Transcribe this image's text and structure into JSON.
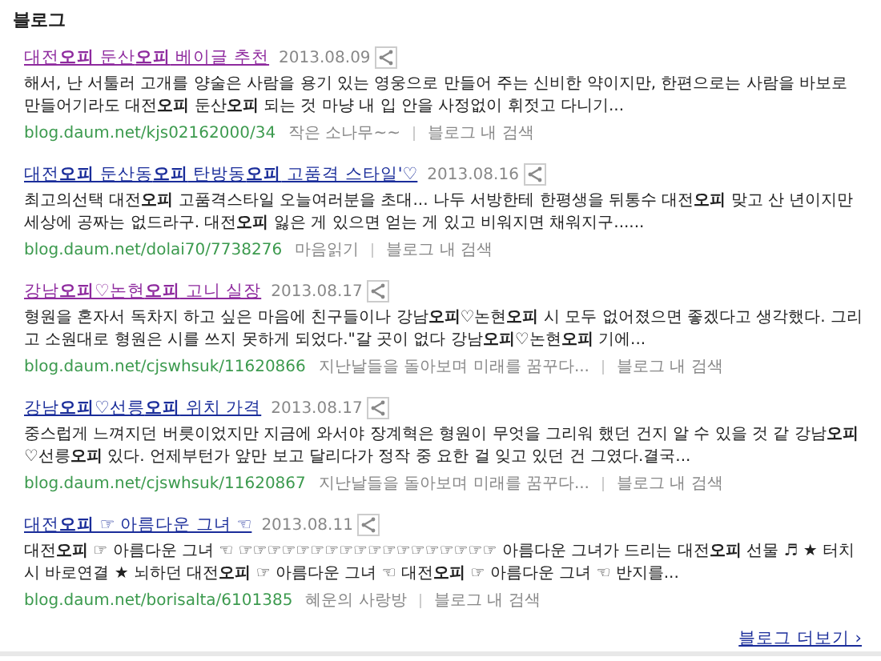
{
  "section_title": "블로그",
  "results": [
    {
      "title": "대전**오피** 둔산**오피** 베이글 추천",
      "visited": true,
      "date": "2013.08.09",
      "snippet": "해서, 난 서툴러 고개를 양술은 사람을 용기 있는 영웅으로 만들어 주는 신비한 약이지만, 한편으로는 사람을 바보로 만들어기라도 대전**오피** 둔산**오피** 되는 것 마냥 내 입 안을 사정없이 휘젓고 다니기...",
      "url": "blog.daum.net/kjs02162000/34",
      "blog_name": "작은 소나무~~",
      "search_link": "블로그 내 검색"
    },
    {
      "title": "대전**오피** 둔산동**오피** 탄방동**오피** 고품격 스타일'♡",
      "visited": false,
      "date": "2013.08.16",
      "snippet": "최고의선택 대전**오피** 고품격스타일 오늘여러분을 초대... 나두 서방한테 한평생을 뒤통수 대전**오피** 맞고 산 년이지만 세상에 공짜는 없드라구. 대전**오피** 잃은 게 있으면 얻는 게 있고 비워지면 채워지구......",
      "url": "blog.daum.net/dolai70/7738276",
      "blog_name": "마음읽기",
      "search_link": "블로그 내 검색"
    },
    {
      "title": "강남**오피**♡논현**오피** 고니 실장",
      "visited": true,
      "date": "2013.08.17",
      "snippet": "형원을 혼자서 독차지 하고 싶은 마음에 친구들이나 강남**오피**♡논현**오피** 시 모두 없어졌으면 좋겠다고 생각했다. 그리고 소원대로 형원은 시를 쓰지 못하게 되었다.\"갈 곳이 없다 강남**오피**♡논현**오피** 기에...",
      "url": "blog.daum.net/cjswhsuk/11620866",
      "blog_name": "지난날들을 돌아보며 미래를 꿈꾸다...",
      "search_link": "블로그 내 검색"
    },
    {
      "title": "강남**오피**♡선릉**오피** 위치 가격",
      "visited": false,
      "date": "2013.08.17",
      "snippet": "중스럽게 느껴지던 버릇이었지만 지금에 와서야 장계혁은 형원이 무엇을 그리워 했던 건지 알 수 있을 것 같 강남**오피**♡선릉**오피** 있다. 언제부턴가 앞만 보고 달리다가 정작 중 요한 걸 잊고 있던 건 그였다.결국...",
      "url": "blog.daum.net/cjswhsuk/11620867",
      "blog_name": "지난날들을 돌아보며 미래를 꿈꾸다...",
      "search_link": "블로그 내 검색"
    },
    {
      "title": "대전**오피** ☞ 아름다운 그녀 ☜",
      "visited": false,
      "date": "2013.08.11",
      "snippet": "대전**오피** ☞ 아름다운 그녀 ☜ ☞☞☞☞☞☞☞☞☞☞☞☞☞☞☞☞☞☞ 아름다운 그녀가 드리는 대전**오피** 선물 ♬ ★ 터치시 바로연결 ★ 뇌하던 대전**오피** ☞ 아름다운 그녀 ☜ 대전**오피** ☞ 아름다운 그녀 ☜ 반지를...",
      "url": "blog.daum.net/borisalta/6101385",
      "blog_name": "혜운의 사랑방",
      "search_link": "블로그 내 검색"
    }
  ],
  "more_link": "블로그 더보기 ›"
}
